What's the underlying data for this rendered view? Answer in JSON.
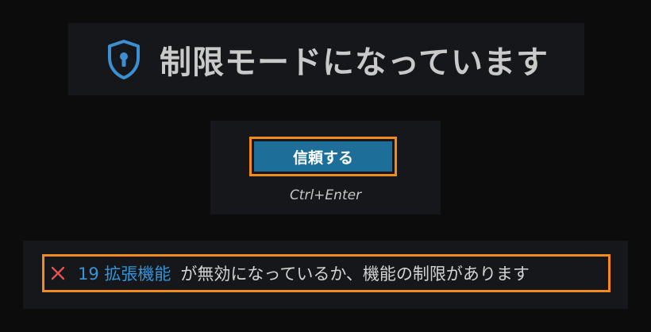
{
  "header": {
    "title": "制限モードになっています",
    "icon": "shield-keyhole-icon",
    "icon_color": "#3c8fd0"
  },
  "trust": {
    "button_label": "信頼する",
    "shortcut": "Ctrl+Enter",
    "button_color": "#1d6f99",
    "highlight_color": "#f28b1c"
  },
  "warning": {
    "icon": "close-x-icon",
    "icon_color": "#e05252",
    "link_text": "19 拡張機能",
    "message": "が無効になっているか、機能の制限があります",
    "link_color": "#3794d6"
  }
}
